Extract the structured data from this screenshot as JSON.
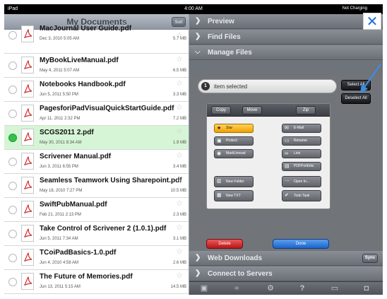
{
  "status_bar": {
    "device": "iPad",
    "time": "4:00 AM",
    "charging": "Not Charging"
  },
  "left_pane": {
    "title": "My Documents",
    "sort_label": "Sort",
    "files": [
      {
        "name": "MacJournal User Guide.pdf",
        "date": "Dec 3, 2010 5:05 AM",
        "size": "5.7 MB",
        "selected": false
      },
      {
        "name": "MyBookLiveManual.pdf",
        "date": "May 4, 2011 5:07 AM",
        "size": "6.5 MB",
        "selected": false
      },
      {
        "name": "Notebooks Handbook.pdf",
        "date": "Jun 5, 2011 5:50 PM",
        "size": "3.3 MB",
        "selected": false
      },
      {
        "name": "PagesforiPadVisualQuickStartGuide.pdf",
        "date": "Apr 11, 2011 2:32 PM",
        "size": "7.2 MB",
        "selected": false
      },
      {
        "name": "SCGS2011 2.pdf",
        "date": "May 30, 2011 8:34 AM",
        "size": "1.9 MB",
        "selected": true
      },
      {
        "name": "Scrivener Manual.pdf",
        "date": "Jun 3, 2011 6:55 PM",
        "size": "3.4 MB",
        "selected": false
      },
      {
        "name": "Seamless Teamwork Using Sharepoint.pdf",
        "date": "May 18, 2010 7:27 PM",
        "size": "10.5 MB",
        "selected": false
      },
      {
        "name": "SwiftPubManual.pdf",
        "date": "Feb 21, 2011 2:13 PM",
        "size": "2.3 MB",
        "selected": false
      },
      {
        "name": "Take Control of Scrivener 2 (1.0.1).pdf",
        "date": "Jun 5, 2011 7:34 AM",
        "size": "3.1 MB",
        "selected": false
      },
      {
        "name": "TCoiPadBasics-1.0.pdf",
        "date": "Jun 4, 2010 4:58 AM",
        "size": "2.6 MB",
        "selected": false
      },
      {
        "name": "The Future of Memories.pdf",
        "date": "Jun 13, 2011 5:15 AM",
        "size": "14.5 MB",
        "selected": false
      }
    ]
  },
  "right_pane": {
    "preview_label": "Preview",
    "find_files_label": "Find Files",
    "manage_files_label": "Manage Files",
    "selected_count": "1",
    "selected_text": "item selected",
    "select_all_label": "Select All",
    "deselect_all_label": "Deselect All",
    "copy_label": "Copy",
    "move_label": "Move",
    "zip_label": "Zip",
    "actions": {
      "star": "Star",
      "email": "E-Mail",
      "protect": "Protect",
      "rename": "Rename",
      "mark_unread": "MarkUnread",
      "link": "Link",
      "pdf_portfolio": "PDFPortfolio",
      "new_folder": "New Folder",
      "open_in": "Open In...",
      "new_txt": "New TXT",
      "todo_task": "Todo Task"
    },
    "delete_label": "Delete",
    "done_label": "Done",
    "web_downloads_label": "Web Downloads",
    "sync_label": "Sync",
    "connect_servers_label": "Connect to Servers"
  },
  "toolbar_icons": [
    "camera-icon",
    "wifi-icon",
    "gear-icon",
    "help-icon",
    "screen-icon",
    "lock-icon"
  ],
  "colors": {
    "selected_row": "#d6f5d6",
    "accent_blue": "#1b6fd6",
    "star_gold": "#f0a000",
    "delete_red": "#c0181c"
  }
}
